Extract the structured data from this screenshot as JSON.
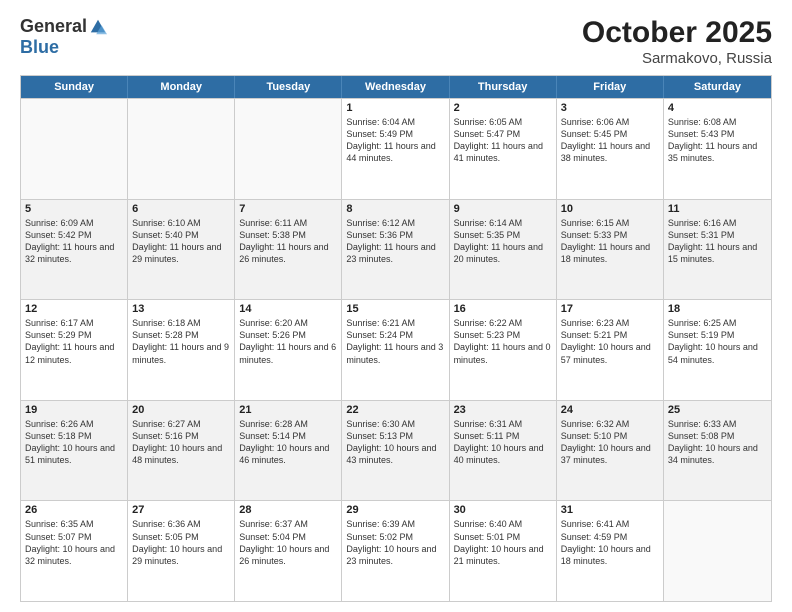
{
  "logo": {
    "general": "General",
    "blue": "Blue"
  },
  "title": "October 2025",
  "subtitle": "Sarmakovo, Russia",
  "days": [
    "Sunday",
    "Monday",
    "Tuesday",
    "Wednesday",
    "Thursday",
    "Friday",
    "Saturday"
  ],
  "weeks": [
    [
      {
        "day": "",
        "info": ""
      },
      {
        "day": "",
        "info": ""
      },
      {
        "day": "",
        "info": ""
      },
      {
        "day": "1",
        "info": "Sunrise: 6:04 AM\nSunset: 5:49 PM\nDaylight: 11 hours and 44 minutes."
      },
      {
        "day": "2",
        "info": "Sunrise: 6:05 AM\nSunset: 5:47 PM\nDaylight: 11 hours and 41 minutes."
      },
      {
        "day": "3",
        "info": "Sunrise: 6:06 AM\nSunset: 5:45 PM\nDaylight: 11 hours and 38 minutes."
      },
      {
        "day": "4",
        "info": "Sunrise: 6:08 AM\nSunset: 5:43 PM\nDaylight: 11 hours and 35 minutes."
      }
    ],
    [
      {
        "day": "5",
        "info": "Sunrise: 6:09 AM\nSunset: 5:42 PM\nDaylight: 11 hours and 32 minutes."
      },
      {
        "day": "6",
        "info": "Sunrise: 6:10 AM\nSunset: 5:40 PM\nDaylight: 11 hours and 29 minutes."
      },
      {
        "day": "7",
        "info": "Sunrise: 6:11 AM\nSunset: 5:38 PM\nDaylight: 11 hours and 26 minutes."
      },
      {
        "day": "8",
        "info": "Sunrise: 6:12 AM\nSunset: 5:36 PM\nDaylight: 11 hours and 23 minutes."
      },
      {
        "day": "9",
        "info": "Sunrise: 6:14 AM\nSunset: 5:35 PM\nDaylight: 11 hours and 20 minutes."
      },
      {
        "day": "10",
        "info": "Sunrise: 6:15 AM\nSunset: 5:33 PM\nDaylight: 11 hours and 18 minutes."
      },
      {
        "day": "11",
        "info": "Sunrise: 6:16 AM\nSunset: 5:31 PM\nDaylight: 11 hours and 15 minutes."
      }
    ],
    [
      {
        "day": "12",
        "info": "Sunrise: 6:17 AM\nSunset: 5:29 PM\nDaylight: 11 hours and 12 minutes."
      },
      {
        "day": "13",
        "info": "Sunrise: 6:18 AM\nSunset: 5:28 PM\nDaylight: 11 hours and 9 minutes."
      },
      {
        "day": "14",
        "info": "Sunrise: 6:20 AM\nSunset: 5:26 PM\nDaylight: 11 hours and 6 minutes."
      },
      {
        "day": "15",
        "info": "Sunrise: 6:21 AM\nSunset: 5:24 PM\nDaylight: 11 hours and 3 minutes."
      },
      {
        "day": "16",
        "info": "Sunrise: 6:22 AM\nSunset: 5:23 PM\nDaylight: 11 hours and 0 minutes."
      },
      {
        "day": "17",
        "info": "Sunrise: 6:23 AM\nSunset: 5:21 PM\nDaylight: 10 hours and 57 minutes."
      },
      {
        "day": "18",
        "info": "Sunrise: 6:25 AM\nSunset: 5:19 PM\nDaylight: 10 hours and 54 minutes."
      }
    ],
    [
      {
        "day": "19",
        "info": "Sunrise: 6:26 AM\nSunset: 5:18 PM\nDaylight: 10 hours and 51 minutes."
      },
      {
        "day": "20",
        "info": "Sunrise: 6:27 AM\nSunset: 5:16 PM\nDaylight: 10 hours and 48 minutes."
      },
      {
        "day": "21",
        "info": "Sunrise: 6:28 AM\nSunset: 5:14 PM\nDaylight: 10 hours and 46 minutes."
      },
      {
        "day": "22",
        "info": "Sunrise: 6:30 AM\nSunset: 5:13 PM\nDaylight: 10 hours and 43 minutes."
      },
      {
        "day": "23",
        "info": "Sunrise: 6:31 AM\nSunset: 5:11 PM\nDaylight: 10 hours and 40 minutes."
      },
      {
        "day": "24",
        "info": "Sunrise: 6:32 AM\nSunset: 5:10 PM\nDaylight: 10 hours and 37 minutes."
      },
      {
        "day": "25",
        "info": "Sunrise: 6:33 AM\nSunset: 5:08 PM\nDaylight: 10 hours and 34 minutes."
      }
    ],
    [
      {
        "day": "26",
        "info": "Sunrise: 6:35 AM\nSunset: 5:07 PM\nDaylight: 10 hours and 32 minutes."
      },
      {
        "day": "27",
        "info": "Sunrise: 6:36 AM\nSunset: 5:05 PM\nDaylight: 10 hours and 29 minutes."
      },
      {
        "day": "28",
        "info": "Sunrise: 6:37 AM\nSunset: 5:04 PM\nDaylight: 10 hours and 26 minutes."
      },
      {
        "day": "29",
        "info": "Sunrise: 6:39 AM\nSunset: 5:02 PM\nDaylight: 10 hours and 23 minutes."
      },
      {
        "day": "30",
        "info": "Sunrise: 6:40 AM\nSunset: 5:01 PM\nDaylight: 10 hours and 21 minutes."
      },
      {
        "day": "31",
        "info": "Sunrise: 6:41 AM\nSunset: 4:59 PM\nDaylight: 10 hours and 18 minutes."
      },
      {
        "day": "",
        "info": ""
      }
    ]
  ]
}
